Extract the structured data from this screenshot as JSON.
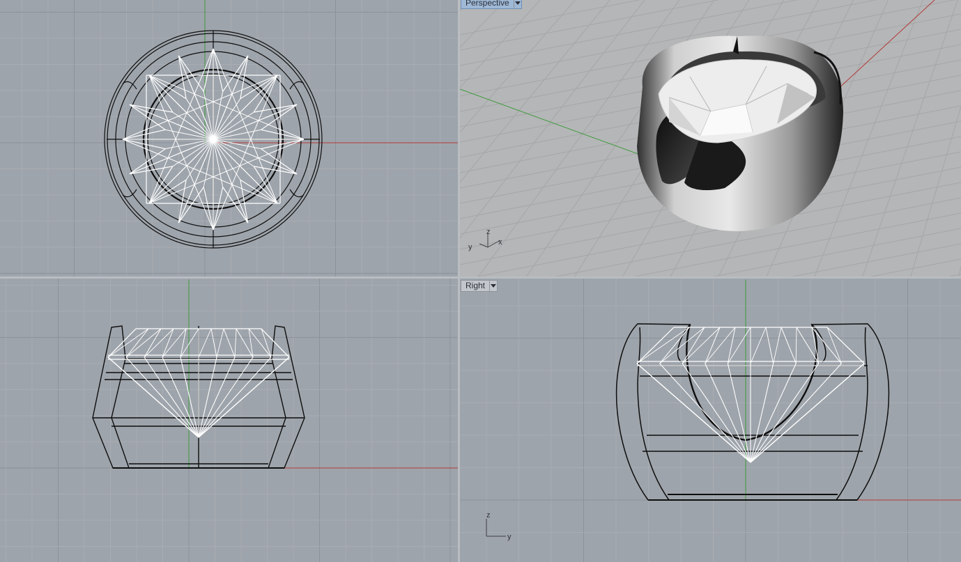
{
  "viewports": {
    "top": {
      "label": ""
    },
    "perspective": {
      "label": "Perspective",
      "axes": {
        "x": "x",
        "y": "y",
        "z": "z"
      }
    },
    "front": {
      "label": ""
    },
    "right": {
      "label": "Right",
      "axes": {
        "y": "y",
        "z": "z"
      }
    }
  },
  "colors": {
    "viewport_bg": "#9ea4ab",
    "perspective_bg": "#b5b6b7",
    "grid_minor": "#a8adb3",
    "grid_major": "#8c9299",
    "x_axis": "#b23a3a",
    "y_axis": "#3a9a3a",
    "wire_dark": "#0d0d0d",
    "wire_light": "#ffffff",
    "active_tab": "#9fb8d6"
  }
}
